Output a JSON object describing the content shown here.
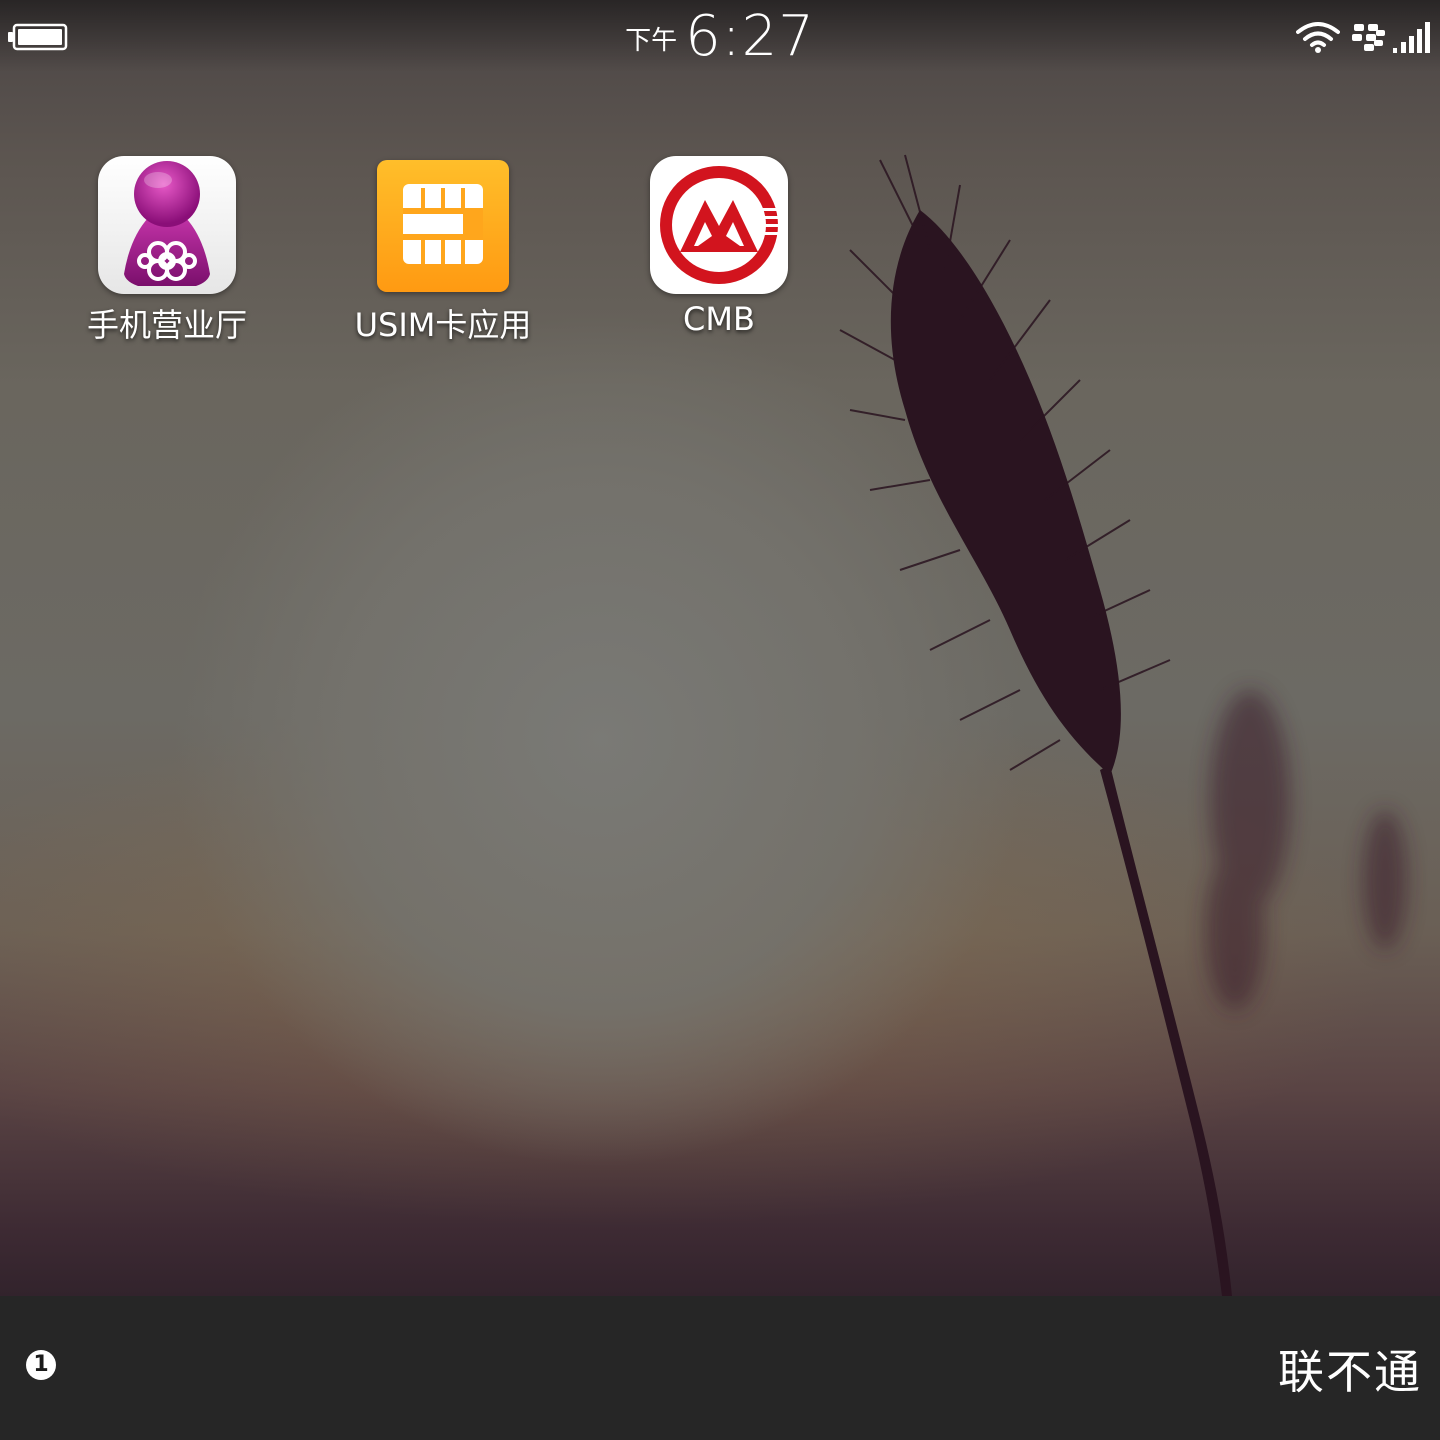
{
  "status_bar": {
    "time_period": "下午",
    "time": "6:27",
    "icons": [
      "battery-icon",
      "wifi-icon",
      "bbm-icon",
      "signal-icon"
    ]
  },
  "apps": [
    {
      "label": "手机营业厅",
      "icon": "unicom-icon"
    },
    {
      "label": "USIM卡应用",
      "icon": "sim-card-icon"
    },
    {
      "label": "CMB",
      "icon": "cmb-icon"
    }
  ],
  "bottom_bar": {
    "notification_count": "1",
    "carrier": "联不通"
  },
  "colors": {
    "bottom_bar": "#262626",
    "usim_orange": "#ffa61c",
    "cmb_red": "#d2141e",
    "unicom_purple": "#b0208c"
  }
}
